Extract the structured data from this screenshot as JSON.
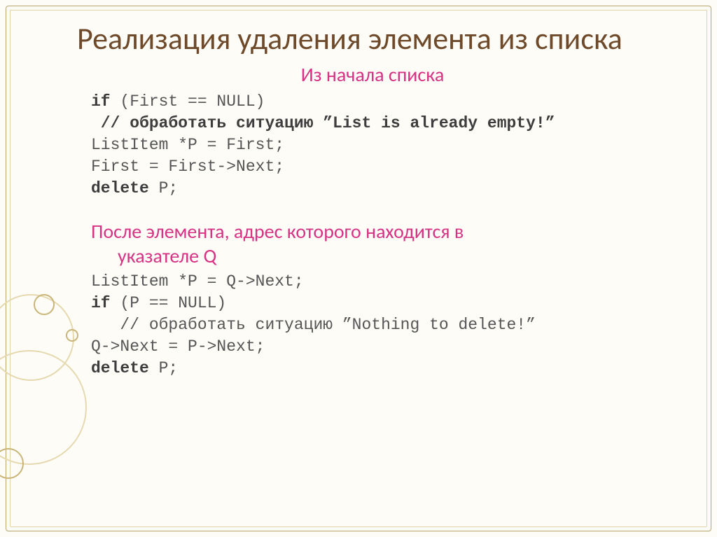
{
  "title": "Реализация удаления элемента из списка",
  "section1": {
    "heading": "Из начала списка",
    "code_line1_pre": "if",
    "code_line1_post": " (First == NULL)",
    "code_line2": " // обработать ситуацию ”List is already empty!”",
    "code_line3": "ListItem *P = First;",
    "code_line4": "First = First->Next;",
    "code_line5_pre": "delete",
    "code_line5_post": " P;"
  },
  "section2": {
    "heading_l1": "После элемента, адрес которого находится в",
    "heading_l2": "указателе Q",
    "code_line1": "ListItem *P = Q->Next;",
    "code_line2_pre": "if",
    "code_line2_post": " (P == NULL)",
    "code_line3": "   // обработать ситуацию ”Nothing to delete!”",
    "code_line4": "Q->Next = P->Next;",
    "code_line5_pre": "delete",
    "code_line5_post": " P;"
  }
}
